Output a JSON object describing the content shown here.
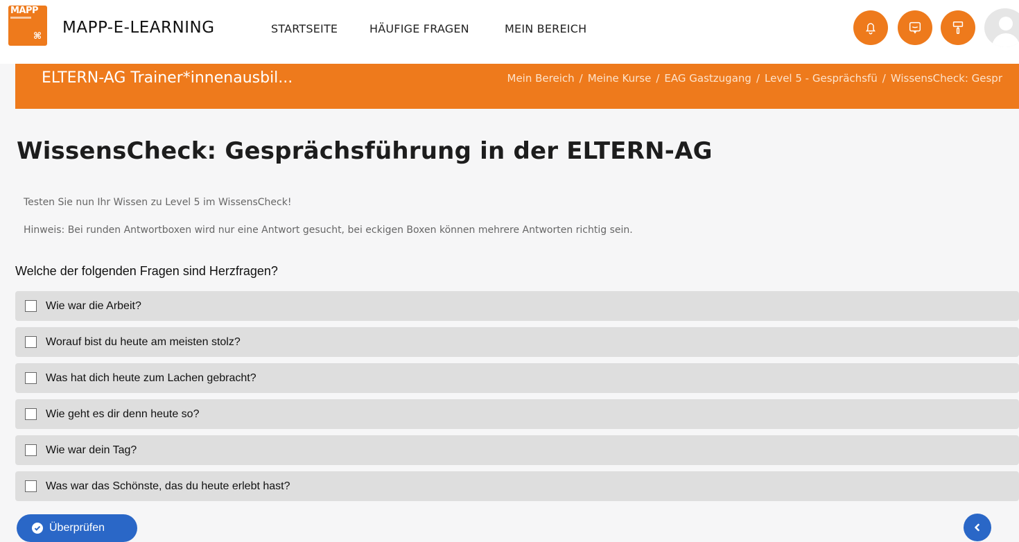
{
  "app": {
    "logo_text": "MAPP",
    "brand": "MAPP-E-LEARNING"
  },
  "nav": {
    "items": [
      {
        "label": "STARTSEITE"
      },
      {
        "label": "HÄUFIGE FRAGEN"
      },
      {
        "label": "MEIN BEREICH"
      }
    ],
    "icons": [
      "bell-icon",
      "chat-icon",
      "brush-icon"
    ]
  },
  "colors": {
    "accent": "#ee7a1c",
    "primary_button": "#2a67c7",
    "answer_bg": "#dedede"
  },
  "banner": {
    "course_title": "ELTERN-AG Trainer*innenausbil...",
    "breadcrumb": [
      "Mein Bereich",
      "Meine Kurse",
      "EAG Gastzugang",
      "Level 5 - Gesprächsfü",
      "WissensCheck: Gespr"
    ]
  },
  "page": {
    "title": "WissensCheck: Gesprächsführung in der ELTERN-AG",
    "intro": "Testen Sie nun Ihr Wissen zu Level 5 im WissensCheck!",
    "hint": "Hinweis: Bei runden Antwortboxen wird nur eine Antwort gesucht, bei eckigen Boxen können mehrere Antworten richtig sein."
  },
  "quiz": {
    "question": "Welche der folgenden Fragen sind Herzfragen?",
    "answers": [
      {
        "label": "Wie war die Arbeit?",
        "checked": false
      },
      {
        "label": "Worauf bist du heute am meisten stolz?",
        "checked": false
      },
      {
        "label": "Was hat dich heute zum Lachen gebracht?",
        "checked": false
      },
      {
        "label": "Wie geht es dir denn heute so?",
        "checked": false
      },
      {
        "label": "Wie war dein Tag?",
        "checked": false
      },
      {
        "label": "Was war das Schönste, das du heute erlebt hast?",
        "checked": false
      }
    ],
    "check_label": "Überprüfen"
  }
}
